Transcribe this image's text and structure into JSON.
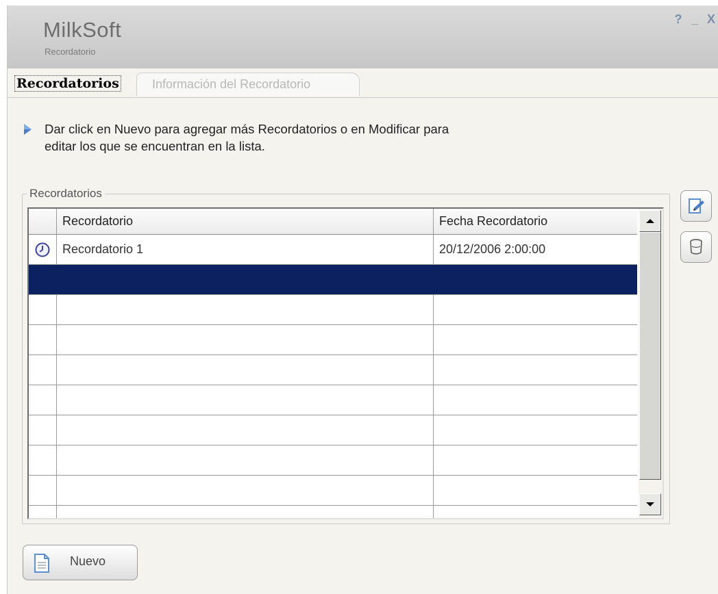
{
  "header": {
    "title": "MilkSoft",
    "subtitle": "Recordatorio",
    "controls": [
      "?",
      "_",
      "X"
    ]
  },
  "tabs": [
    {
      "label": "Recordatorios",
      "active": true
    },
    {
      "label": "Información del Recordatorio",
      "active": false
    }
  ],
  "hint": {
    "line1": "Dar click en Nuevo para agregar más Recordatorios o en Modificar para",
    "line2": "editar los que se encuentran en la lista."
  },
  "group": {
    "label": "Recordatorios"
  },
  "grid": {
    "columns": [
      "Recordatorio",
      "Fecha Recordatorio"
    ],
    "rows": [
      {
        "icon": "clock-icon",
        "name": "Recordatorio 1",
        "date": "20/12/2006 2:00:00"
      }
    ],
    "selected_row": 2
  },
  "buttons": {
    "nuevo": "Nuevo",
    "modificar_icon": "edit-icon",
    "eliminar_icon": "trash-icon"
  },
  "colors": {
    "selection": "#0b2160",
    "header_bg": "#cdcdcd"
  }
}
